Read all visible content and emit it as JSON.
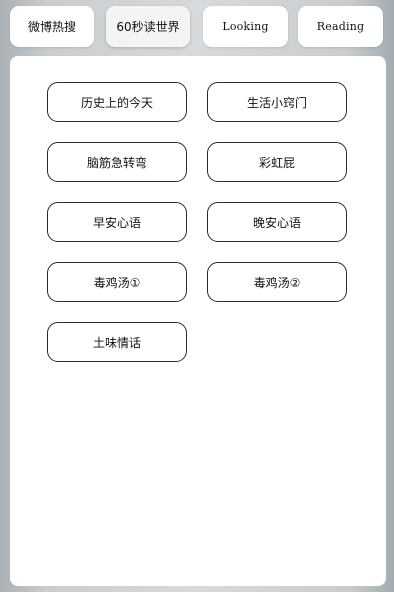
{
  "tabs": [
    {
      "label": "微博热搜"
    },
    {
      "label": "60秒读世界"
    },
    {
      "label": "Looking"
    },
    {
      "label": "Reading"
    }
  ],
  "buttons": [
    {
      "label": "历史上的今天"
    },
    {
      "label": "生活小窍门"
    },
    {
      "label": "脑筋急转弯"
    },
    {
      "label": "彩虹屁"
    },
    {
      "label": "早安心语"
    },
    {
      "label": "晚安心语"
    },
    {
      "label": "毒鸡汤①"
    },
    {
      "label": "毒鸡汤②"
    },
    {
      "label": "土味情话"
    }
  ]
}
